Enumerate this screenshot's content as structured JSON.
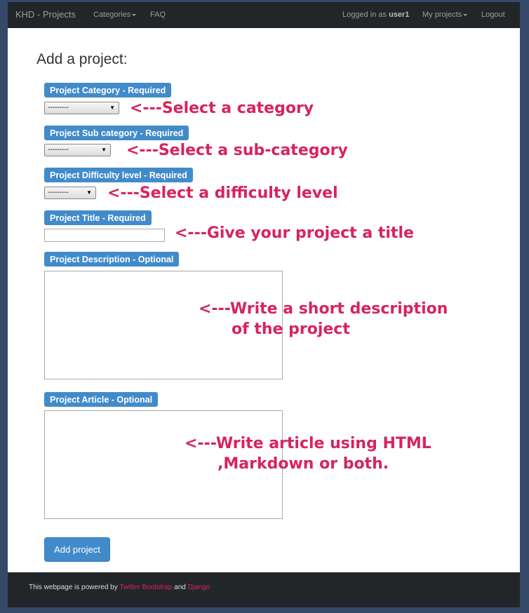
{
  "nav": {
    "brand": "KHD - Projects",
    "categories": "Categories",
    "faq": "FAQ",
    "logged_prefix": "Logged in as ",
    "user": "user1",
    "my_projects": "My projects",
    "logout": "Logout"
  },
  "page_title": "Add a project:",
  "fields": {
    "category": {
      "label": "Project Category - Required",
      "value": "---------",
      "note": "<---Select a category"
    },
    "subcategory": {
      "label": "Project Sub category - Required",
      "value": "---------",
      "note": "<---Select a sub-category"
    },
    "difficulty": {
      "label": "Project Difficulty level - Required",
      "value": "---------",
      "note": "<---Select a difficulty level"
    },
    "title": {
      "label": "Project Title - Required",
      "value": "",
      "note": "<---Give your project a title"
    },
    "description": {
      "label": "Project Description - Optional",
      "note1": "<---Write a short description",
      "note2": "of the project"
    },
    "article": {
      "label": "Project Article - Optional",
      "note1": "<---Write article using HTML",
      "note2": ",Markdown or both."
    }
  },
  "submit": "Add project",
  "footer": {
    "prefix": "This webpage is powered by ",
    "link1": "Twitter Bootstrap",
    "mid": " and ",
    "link2": "Django"
  }
}
